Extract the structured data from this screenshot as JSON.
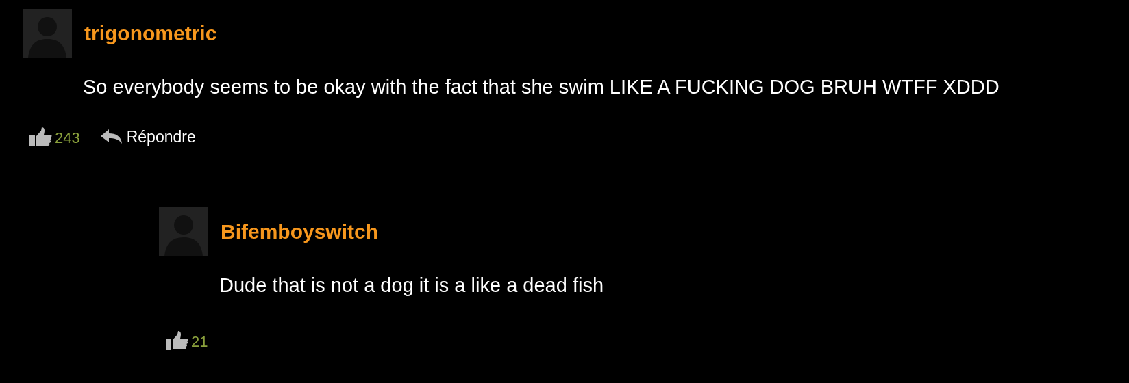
{
  "comments": [
    {
      "author": "trigonometric",
      "text": "So everybody seems to be okay with the fact that she swim LIKE A FUCKING DOG BRUH WTFF XDDD",
      "likes": "243",
      "reply_label": "Répondre",
      "replies": [
        {
          "author": "Bifemboyswitch",
          "text": "Dude that is not a dog it is a like a dead fish",
          "likes": "21"
        }
      ]
    }
  ]
}
